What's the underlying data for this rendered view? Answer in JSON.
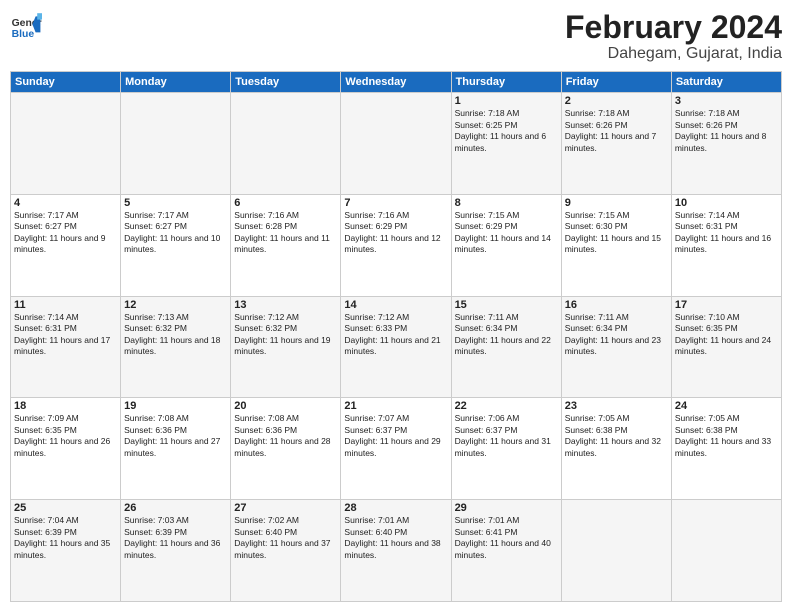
{
  "header": {
    "logo_general": "General",
    "logo_blue": "Blue",
    "month": "February 2024",
    "location": "Dahegam, Gujarat, India"
  },
  "days_of_week": [
    "Sunday",
    "Monday",
    "Tuesday",
    "Wednesday",
    "Thursday",
    "Friday",
    "Saturday"
  ],
  "weeks": [
    [
      {
        "num": "",
        "info": ""
      },
      {
        "num": "",
        "info": ""
      },
      {
        "num": "",
        "info": ""
      },
      {
        "num": "",
        "info": ""
      },
      {
        "num": "1",
        "info": "Sunrise: 7:18 AM\nSunset: 6:25 PM\nDaylight: 11 hours and 6 minutes."
      },
      {
        "num": "2",
        "info": "Sunrise: 7:18 AM\nSunset: 6:26 PM\nDaylight: 11 hours and 7 minutes."
      },
      {
        "num": "3",
        "info": "Sunrise: 7:18 AM\nSunset: 6:26 PM\nDaylight: 11 hours and 8 minutes."
      }
    ],
    [
      {
        "num": "4",
        "info": "Sunrise: 7:17 AM\nSunset: 6:27 PM\nDaylight: 11 hours and 9 minutes."
      },
      {
        "num": "5",
        "info": "Sunrise: 7:17 AM\nSunset: 6:27 PM\nDaylight: 11 hours and 10 minutes."
      },
      {
        "num": "6",
        "info": "Sunrise: 7:16 AM\nSunset: 6:28 PM\nDaylight: 11 hours and 11 minutes."
      },
      {
        "num": "7",
        "info": "Sunrise: 7:16 AM\nSunset: 6:29 PM\nDaylight: 11 hours and 12 minutes."
      },
      {
        "num": "8",
        "info": "Sunrise: 7:15 AM\nSunset: 6:29 PM\nDaylight: 11 hours and 14 minutes."
      },
      {
        "num": "9",
        "info": "Sunrise: 7:15 AM\nSunset: 6:30 PM\nDaylight: 11 hours and 15 minutes."
      },
      {
        "num": "10",
        "info": "Sunrise: 7:14 AM\nSunset: 6:31 PM\nDaylight: 11 hours and 16 minutes."
      }
    ],
    [
      {
        "num": "11",
        "info": "Sunrise: 7:14 AM\nSunset: 6:31 PM\nDaylight: 11 hours and 17 minutes."
      },
      {
        "num": "12",
        "info": "Sunrise: 7:13 AM\nSunset: 6:32 PM\nDaylight: 11 hours and 18 minutes."
      },
      {
        "num": "13",
        "info": "Sunrise: 7:12 AM\nSunset: 6:32 PM\nDaylight: 11 hours and 19 minutes."
      },
      {
        "num": "14",
        "info": "Sunrise: 7:12 AM\nSunset: 6:33 PM\nDaylight: 11 hours and 21 minutes."
      },
      {
        "num": "15",
        "info": "Sunrise: 7:11 AM\nSunset: 6:34 PM\nDaylight: 11 hours and 22 minutes."
      },
      {
        "num": "16",
        "info": "Sunrise: 7:11 AM\nSunset: 6:34 PM\nDaylight: 11 hours and 23 minutes."
      },
      {
        "num": "17",
        "info": "Sunrise: 7:10 AM\nSunset: 6:35 PM\nDaylight: 11 hours and 24 minutes."
      }
    ],
    [
      {
        "num": "18",
        "info": "Sunrise: 7:09 AM\nSunset: 6:35 PM\nDaylight: 11 hours and 26 minutes."
      },
      {
        "num": "19",
        "info": "Sunrise: 7:08 AM\nSunset: 6:36 PM\nDaylight: 11 hours and 27 minutes."
      },
      {
        "num": "20",
        "info": "Sunrise: 7:08 AM\nSunset: 6:36 PM\nDaylight: 11 hours and 28 minutes."
      },
      {
        "num": "21",
        "info": "Sunrise: 7:07 AM\nSunset: 6:37 PM\nDaylight: 11 hours and 29 minutes."
      },
      {
        "num": "22",
        "info": "Sunrise: 7:06 AM\nSunset: 6:37 PM\nDaylight: 11 hours and 31 minutes."
      },
      {
        "num": "23",
        "info": "Sunrise: 7:05 AM\nSunset: 6:38 PM\nDaylight: 11 hours and 32 minutes."
      },
      {
        "num": "24",
        "info": "Sunrise: 7:05 AM\nSunset: 6:38 PM\nDaylight: 11 hours and 33 minutes."
      }
    ],
    [
      {
        "num": "25",
        "info": "Sunrise: 7:04 AM\nSunset: 6:39 PM\nDaylight: 11 hours and 35 minutes."
      },
      {
        "num": "26",
        "info": "Sunrise: 7:03 AM\nSunset: 6:39 PM\nDaylight: 11 hours and 36 minutes."
      },
      {
        "num": "27",
        "info": "Sunrise: 7:02 AM\nSunset: 6:40 PM\nDaylight: 11 hours and 37 minutes."
      },
      {
        "num": "28",
        "info": "Sunrise: 7:01 AM\nSunset: 6:40 PM\nDaylight: 11 hours and 38 minutes."
      },
      {
        "num": "29",
        "info": "Sunrise: 7:01 AM\nSunset: 6:41 PM\nDaylight: 11 hours and 40 minutes."
      },
      {
        "num": "",
        "info": ""
      },
      {
        "num": "",
        "info": ""
      }
    ]
  ]
}
